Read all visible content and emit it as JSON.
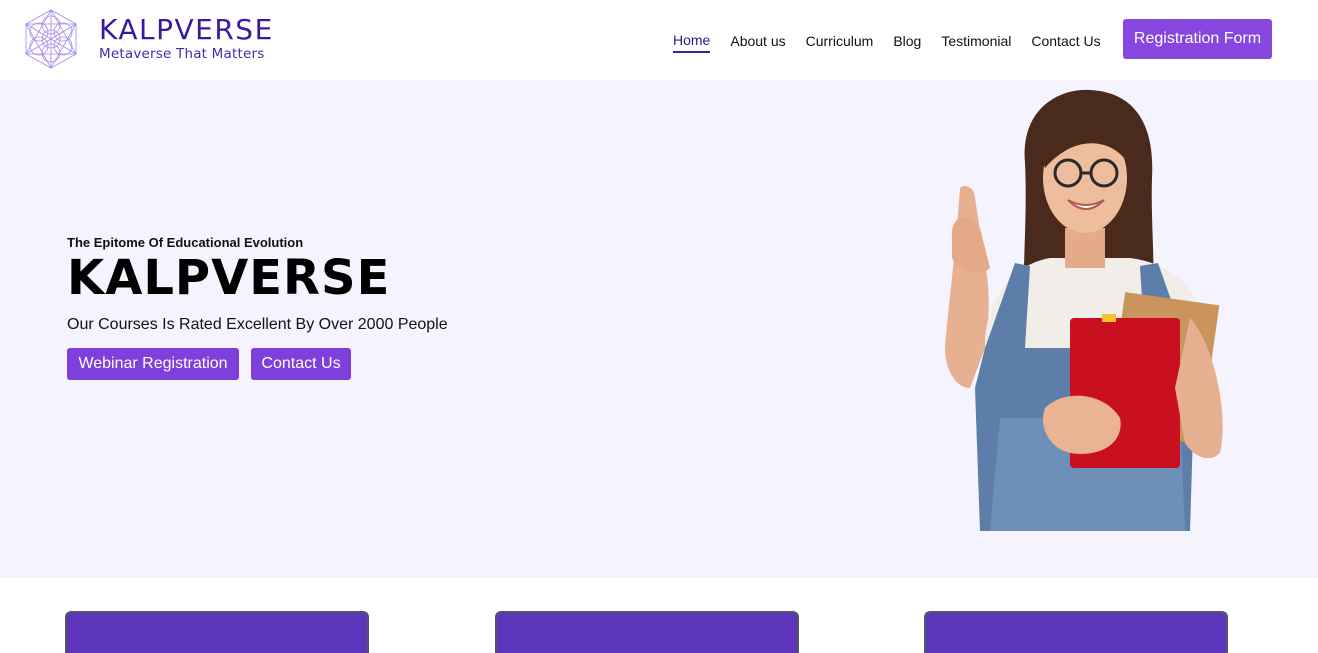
{
  "brand": {
    "name": "KALPVERSE",
    "tagline": "Metaverse That Matters",
    "logo_icon": "sacred-geometry-logo-icon"
  },
  "nav": {
    "items": [
      {
        "label": "Home",
        "active": true
      },
      {
        "label": "About us",
        "active": false
      },
      {
        "label": "Curriculum",
        "active": false
      },
      {
        "label": "Blog",
        "active": false
      },
      {
        "label": "Testimonial",
        "active": false
      },
      {
        "label": "Contact Us",
        "active": false
      }
    ],
    "cta_label": "Registration Form"
  },
  "hero": {
    "eyebrow": "The Epitome Of Educational Evolution",
    "title": "KALPVERSE",
    "subtitle": "Our Courses Is Rated Excellent By Over 2000 People",
    "primary_button": "Webinar Registration",
    "secondary_button": "Contact Us",
    "image_icon": "student-with-books-image"
  },
  "colors": {
    "brand": "#3c1a9e",
    "accent": "#8746e0",
    "hero_bg": "#f5f3fd",
    "card": "#5d35bd"
  }
}
